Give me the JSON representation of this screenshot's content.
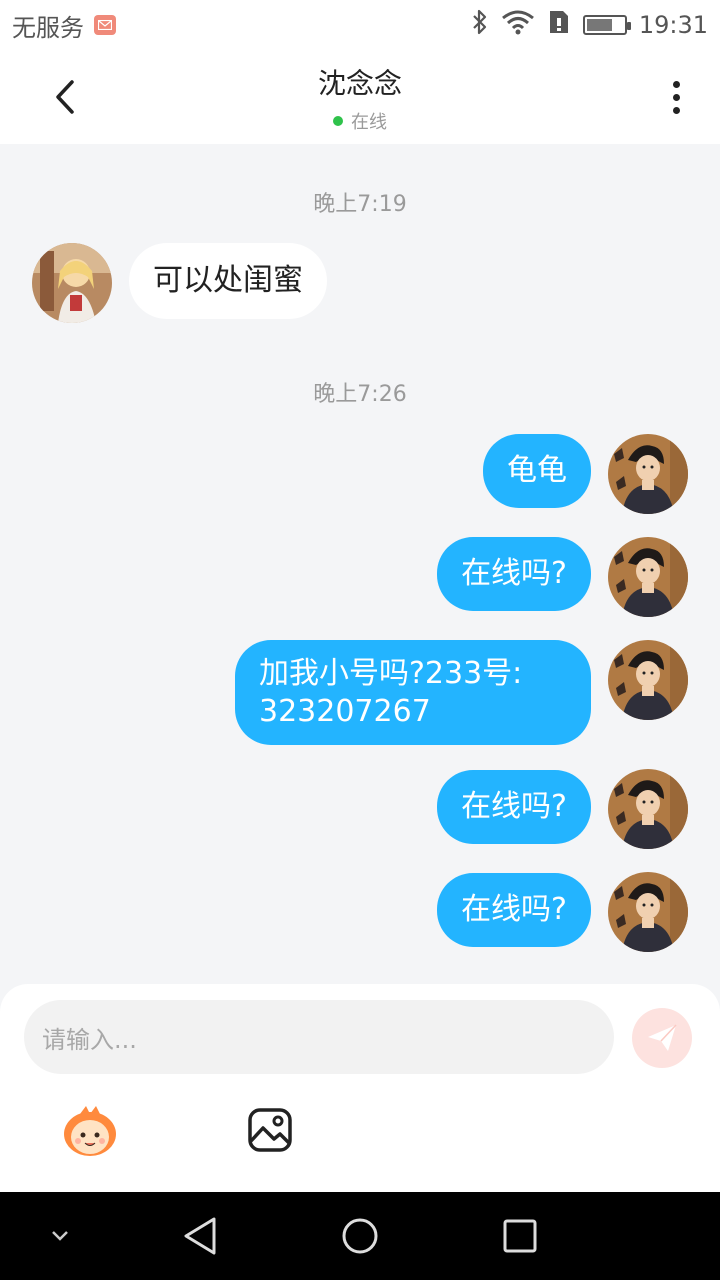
{
  "status_bar": {
    "carrier": "无服务",
    "time": "19:31",
    "battery_level": 0.7,
    "icons": [
      "mail-icon",
      "bluetooth-icon",
      "wifi-icon",
      "sim-icon",
      "battery-icon"
    ]
  },
  "header": {
    "title": "沈念念",
    "status": "在线",
    "status_color": "#2fc24b"
  },
  "chat": {
    "timestamps": [
      "晚上7:19",
      "晚上7:26"
    ],
    "incoming": [
      {
        "text": "可以处闺蜜"
      }
    ],
    "outgoing": [
      {
        "text": "龟龟"
      },
      {
        "text": "在线吗?"
      },
      {
        "line1": "加我小号吗?233号:",
        "line2": "323207267"
      },
      {
        "text": "在线吗?"
      },
      {
        "text": "在线吗?"
      }
    ],
    "outgoing_color": "#23b4ff"
  },
  "input": {
    "placeholder": "请输入...",
    "send_icon": "send-icon"
  },
  "toolbar": {
    "emoji_icon": "emoji-icon",
    "image_icon": "image-icon"
  },
  "nav": {
    "icons": [
      "chevron-down-icon",
      "back-triangle-icon",
      "home-circle-icon",
      "recents-square-icon"
    ]
  }
}
